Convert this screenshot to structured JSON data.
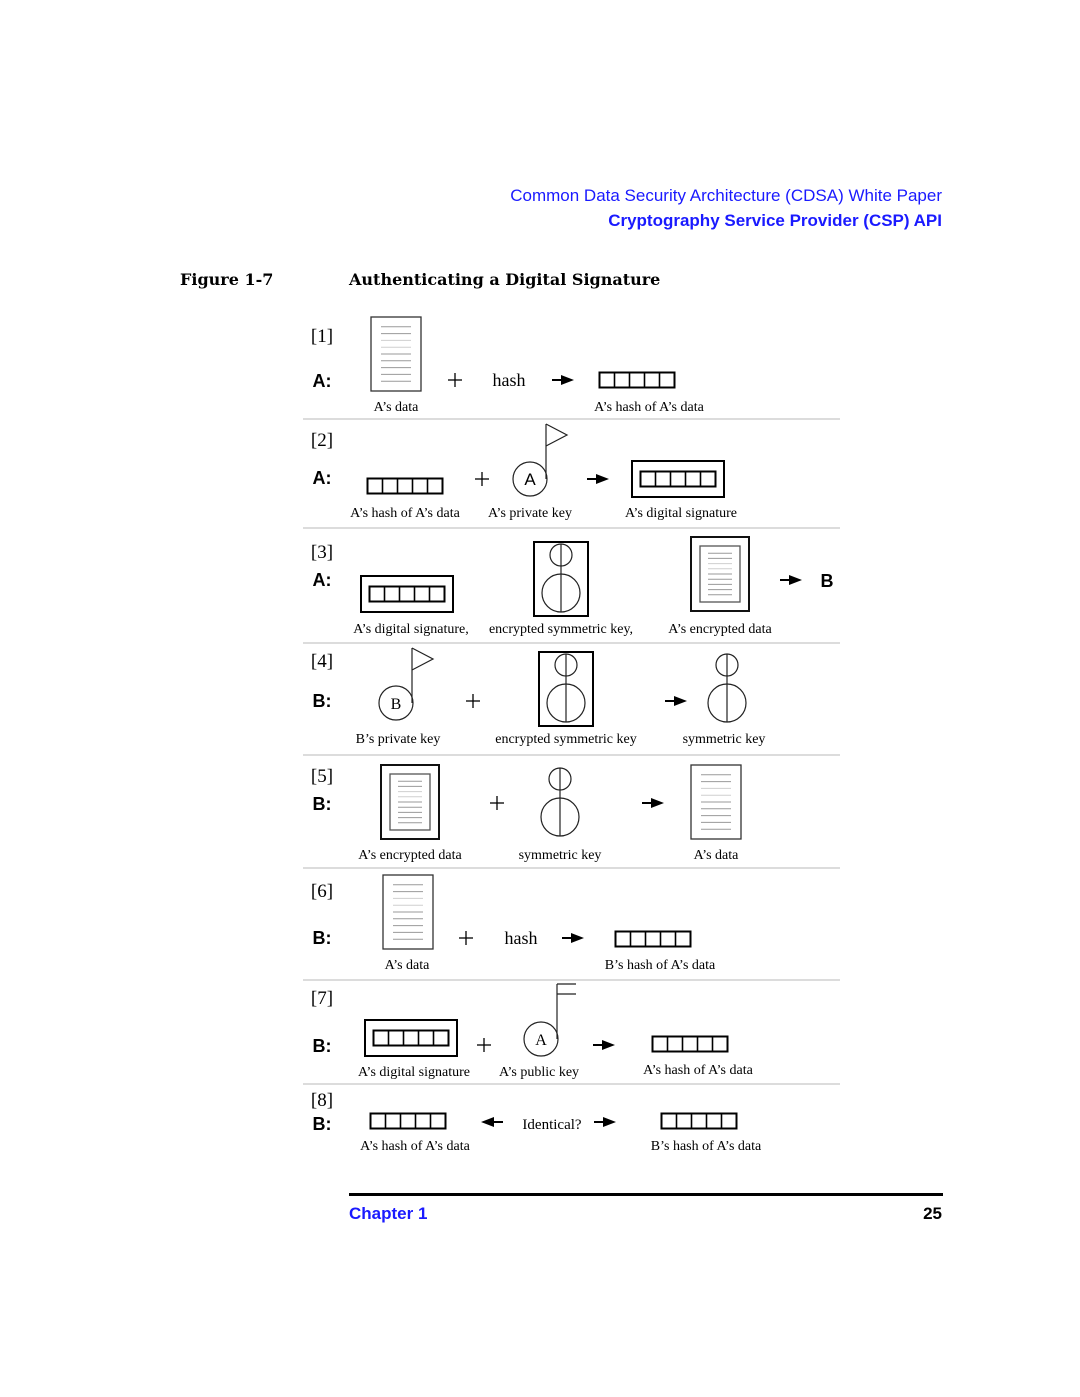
{
  "header": {
    "doc_title": "Common Data Security Architecture (CDSA) White Paper",
    "section_title": "Cryptography Service Provider (CSP) API"
  },
  "figure": {
    "label": "Figure 1-7",
    "title": "Authenticating a Digital Signature"
  },
  "icons": {
    "plus": "+",
    "arrow_right": "right-arrow-icon",
    "arrow_left": "left-arrow-icon",
    "document": "document-icon",
    "hash_blocks": "hash-blocks-icon",
    "signature": "digital-signature-icon",
    "private_key": "private-key-icon",
    "public_key": "public-key-icon",
    "symmetric_key": "symmetric-key-icon",
    "encrypted_key": "encrypted-key-icon",
    "encrypted_document": "encrypted-document-icon"
  },
  "steps": [
    {
      "number": "[1]",
      "actor": "A:",
      "items": [
        {
          "kind": "document",
          "caption": "A’s data"
        },
        {
          "kind": "plus"
        },
        {
          "kind": "word",
          "text": "hash"
        },
        {
          "kind": "arrow"
        },
        {
          "kind": "hash",
          "caption": "A’s hash of A’s data"
        }
      ]
    },
    {
      "number": "[2]",
      "actor": "A:",
      "items": [
        {
          "kind": "hash",
          "caption": "A’s hash of A’s  data"
        },
        {
          "kind": "plus"
        },
        {
          "kind": "private_key",
          "letter": "A",
          "caption": "A’s private key"
        },
        {
          "kind": "arrow"
        },
        {
          "kind": "signature",
          "caption": "A’s digital signature"
        }
      ]
    },
    {
      "number": "[3]",
      "actor": "A:",
      "items": [
        {
          "kind": "signature",
          "caption": "A’s digital signature,"
        },
        {
          "kind": "encrypted_key",
          "caption": "encrypted symmetric key,"
        },
        {
          "kind": "encrypted_document",
          "caption": "A’s encrypted data"
        },
        {
          "kind": "arrow"
        },
        {
          "kind": "recipient",
          "text": "B"
        }
      ]
    },
    {
      "number": "[4]",
      "actor": "B:",
      "items": [
        {
          "kind": "private_key",
          "letter": "B",
          "caption": "B’s private key"
        },
        {
          "kind": "plus"
        },
        {
          "kind": "encrypted_key",
          "caption": "encrypted symmetric key"
        },
        {
          "kind": "arrow"
        },
        {
          "kind": "symmetric_key",
          "caption": "symmetric key"
        }
      ]
    },
    {
      "number": "[5]",
      "actor": "B:",
      "items": [
        {
          "kind": "encrypted_document",
          "caption": "A’s encrypted data"
        },
        {
          "kind": "plus"
        },
        {
          "kind": "symmetric_key",
          "caption": "symmetric key"
        },
        {
          "kind": "arrow"
        },
        {
          "kind": "document",
          "caption": "A’s data"
        }
      ]
    },
    {
      "number": "[6]",
      "actor": "B:",
      "items": [
        {
          "kind": "document",
          "caption": "A’s data"
        },
        {
          "kind": "plus"
        },
        {
          "kind": "word",
          "text": "hash"
        },
        {
          "kind": "arrow"
        },
        {
          "kind": "hash",
          "caption": "B’s hash of A’s data"
        }
      ]
    },
    {
      "number": "[7]",
      "actor": "B:",
      "items": [
        {
          "kind": "signature",
          "caption": "A’s digital signature"
        },
        {
          "kind": "plus"
        },
        {
          "kind": "public_key",
          "letter": "A",
          "caption": "A’s public key"
        },
        {
          "kind": "arrow"
        },
        {
          "kind": "hash",
          "caption": "A’s hash of A’s data"
        }
      ]
    },
    {
      "number": "[8]",
      "actor": "B:",
      "items": [
        {
          "kind": "hash",
          "caption": "A’s hash of A’s data"
        },
        {
          "kind": "arrow_left"
        },
        {
          "kind": "word",
          "text": "Identical?"
        },
        {
          "kind": "arrow"
        },
        {
          "kind": "hash",
          "caption": "B’s hash of A’s data"
        }
      ]
    }
  ],
  "footer": {
    "chapter": "Chapter 1",
    "page_number": "25"
  }
}
